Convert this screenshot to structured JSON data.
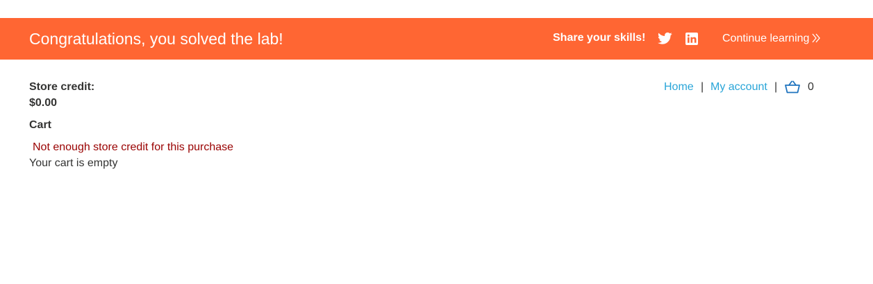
{
  "banner": {
    "title": "Congratulations, you solved the lab!",
    "share_label": "Share your skills!",
    "continue_label": "Continue learning",
    "background_color": "#ff6633"
  },
  "account": {
    "store_credit_label": "Store credit:",
    "store_credit_value": "$0.00"
  },
  "cart": {
    "heading": "Cart",
    "error_message": "Not enough store credit for this purchase",
    "empty_message": "Your cart is empty"
  },
  "nav": {
    "home_label": "Home",
    "separator": "|",
    "my_account_label": "My account",
    "cart_count": "0",
    "link_color": "#29a5d8"
  },
  "icons": {
    "twitter": "twitter-icon",
    "linkedin": "linkedin-icon",
    "continue": "double-chevron-right-icon",
    "cart": "shopping-basket-icon"
  }
}
